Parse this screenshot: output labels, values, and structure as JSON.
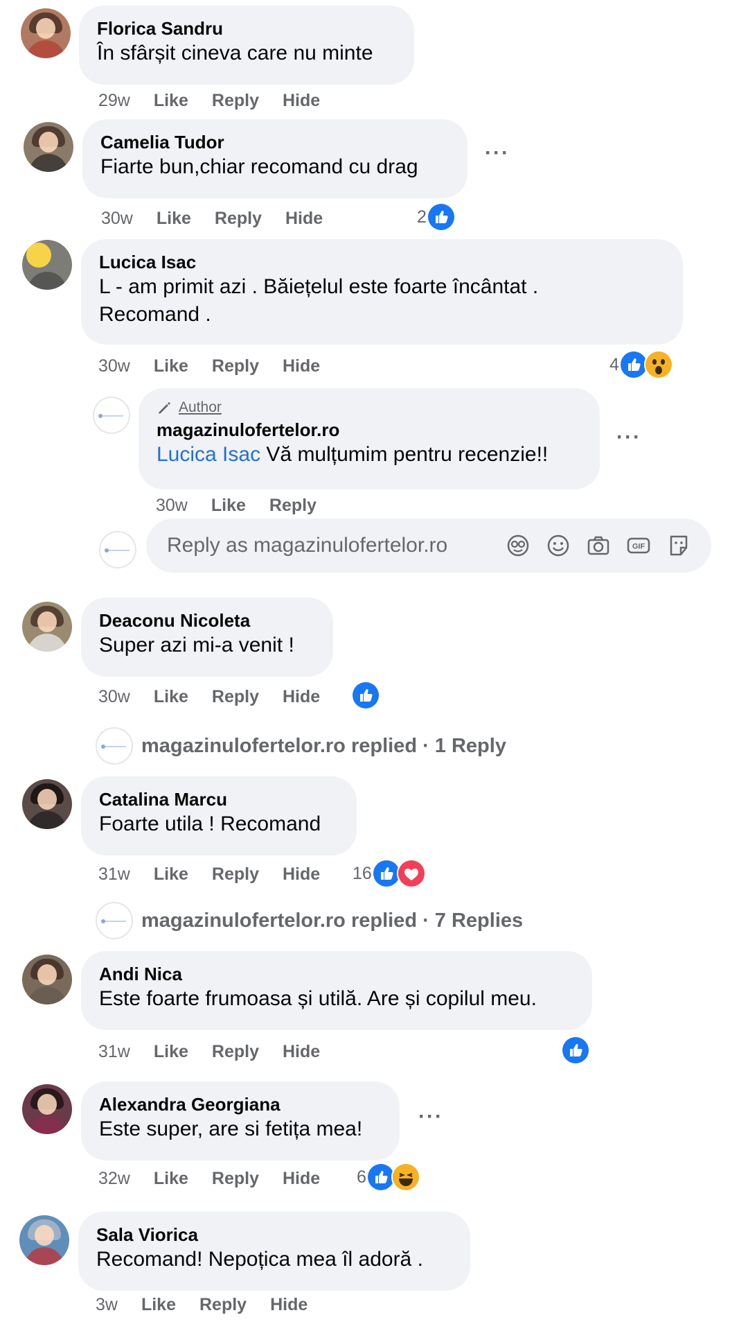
{
  "colors": {
    "accent": "#216fdb",
    "bubble": "#f0f2f5",
    "secondary": "#65676b",
    "like": "#1877f2",
    "love": "#f33e58",
    "wow": "#f7b125"
  },
  "comments": [
    {
      "name": "Florica Sandru",
      "text": "În sfârșit cineva care nu minte",
      "time": "29w",
      "like": "Like",
      "reply": "Hide_placeholder"
    },
    {
      "name": "Camelia Tudor",
      "text": "Fiarte bun,chiar recomand cu drag",
      "time": "30w",
      "reaction_count": "2"
    },
    {
      "name": "Lucica Isac",
      "text": "L - am primit azi . Băiețelul este foarte încântat .",
      "text2": "Recomand .",
      "time": "30w",
      "reaction_count": "4"
    },
    {
      "name": "Deaconu Nicoleta",
      "text": "Super azi mi-a venit !",
      "time": "30w"
    },
    {
      "name": "Catalina Marcu",
      "text": "Foarte utila ! Recomand",
      "time": "31w",
      "reaction_count": "16"
    },
    {
      "name": "Andi Nica",
      "text": "Este foarte frumoasa și utilă. Are și copilul meu.",
      "time": "31w"
    },
    {
      "name": "Alexandra Georgiana",
      "text": "Este super, are si fetița mea!",
      "time": "32w",
      "reaction_count": "6"
    },
    {
      "name": "Sala Viorica",
      "text": "Recomand! Nepoțica mea îl adoră .",
      "time": "3w"
    }
  ],
  "labels": {
    "like": "Like",
    "reply": "Reply",
    "hide": "Hide",
    "more": "···"
  },
  "author_reply": {
    "badge": "Author",
    "name": "magazinulofertelor.ro",
    "mention": "Lucica Isac",
    "text": " Vă mulțumim pentru recenzie!!",
    "time": "30w"
  },
  "reply_box": {
    "placeholder": "Reply as magazinulofertelor.ro",
    "icons": [
      "avatar-sticker-icon",
      "emoji-icon",
      "camera-icon",
      "gif-icon",
      "sticker-icon"
    ]
  },
  "replied_rows": [
    {
      "text": "magazinulofertelor.ro replied · 1 Reply"
    },
    {
      "text": "magazinulofertelor.ro replied · 7 Replies"
    }
  ]
}
